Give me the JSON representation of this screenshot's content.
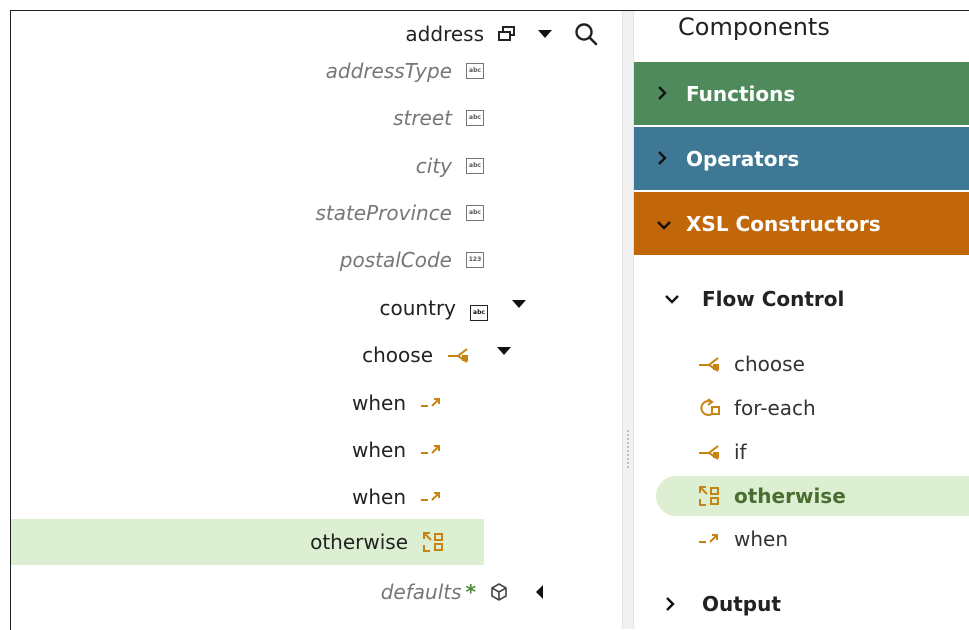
{
  "tree": {
    "address": "address",
    "addressType": "addressType",
    "street": "street",
    "city": "city",
    "stateProvince": "stateProvince",
    "postalCode": "postalCode",
    "country": "country",
    "choose": "choose",
    "when1": "when",
    "when2": "when",
    "when3": "when",
    "otherwise": "otherwise",
    "defaults": "defaults",
    "defaults_marker": "*",
    "icon_abc": "abc",
    "icon_123": "123"
  },
  "components": {
    "title": "Components",
    "sections": {
      "functions": "Functions",
      "operators": "Operators",
      "xsl": "XSL Constructors"
    },
    "flow_control": "Flow Control",
    "items": {
      "choose": "choose",
      "foreach": "for-each",
      "if": "if",
      "otherwise": "otherwise",
      "when": "when"
    },
    "output": "Output"
  },
  "colors": {
    "functions": "#4e8a5c",
    "operators": "#3f7895",
    "xsl": "#c2660a",
    "selected": "#dcefd2",
    "xsl_icon": "#c68412"
  }
}
